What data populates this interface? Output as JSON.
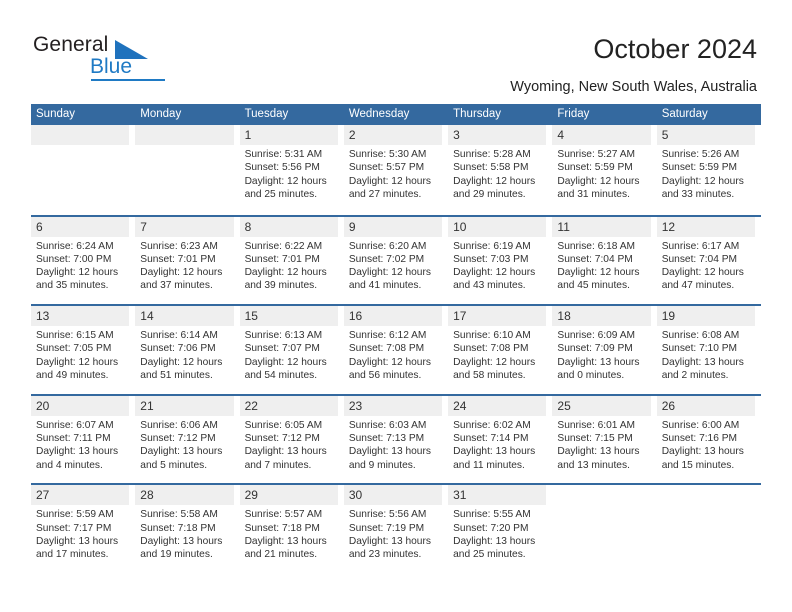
{
  "brand": {
    "name_part1": "General",
    "name_part2": "Blue"
  },
  "header": {
    "title": "October 2024",
    "subtitle": "Wyoming, New South Wales, Australia"
  },
  "calendar": {
    "weekday_headers": [
      "Sunday",
      "Monday",
      "Tuesday",
      "Wednesday",
      "Thursday",
      "Friday",
      "Saturday"
    ],
    "accent_color": "#34699F",
    "numband_color": "#EFEFEF",
    "weeks": [
      [
        {
          "day": "",
          "blank": true
        },
        {
          "day": "",
          "blank": true
        },
        {
          "day": "1",
          "sunrise": "Sunrise: 5:31 AM",
          "sunset": "Sunset: 5:56 PM",
          "daylight1": "Daylight: 12 hours",
          "daylight2": "and 25 minutes."
        },
        {
          "day": "2",
          "sunrise": "Sunrise: 5:30 AM",
          "sunset": "Sunset: 5:57 PM",
          "daylight1": "Daylight: 12 hours",
          "daylight2": "and 27 minutes."
        },
        {
          "day": "3",
          "sunrise": "Sunrise: 5:28 AM",
          "sunset": "Sunset: 5:58 PM",
          "daylight1": "Daylight: 12 hours",
          "daylight2": "and 29 minutes."
        },
        {
          "day": "4",
          "sunrise": "Sunrise: 5:27 AM",
          "sunset": "Sunset: 5:59 PM",
          "daylight1": "Daylight: 12 hours",
          "daylight2": "and 31 minutes."
        },
        {
          "day": "5",
          "sunrise": "Sunrise: 5:26 AM",
          "sunset": "Sunset: 5:59 PM",
          "daylight1": "Daylight: 12 hours",
          "daylight2": "and 33 minutes."
        }
      ],
      [
        {
          "day": "6",
          "sunrise": "Sunrise: 6:24 AM",
          "sunset": "Sunset: 7:00 PM",
          "daylight1": "Daylight: 12 hours",
          "daylight2": "and 35 minutes."
        },
        {
          "day": "7",
          "sunrise": "Sunrise: 6:23 AM",
          "sunset": "Sunset: 7:01 PM",
          "daylight1": "Daylight: 12 hours",
          "daylight2": "and 37 minutes."
        },
        {
          "day": "8",
          "sunrise": "Sunrise: 6:22 AM",
          "sunset": "Sunset: 7:01 PM",
          "daylight1": "Daylight: 12 hours",
          "daylight2": "and 39 minutes."
        },
        {
          "day": "9",
          "sunrise": "Sunrise: 6:20 AM",
          "sunset": "Sunset: 7:02 PM",
          "daylight1": "Daylight: 12 hours",
          "daylight2": "and 41 minutes."
        },
        {
          "day": "10",
          "sunrise": "Sunrise: 6:19 AM",
          "sunset": "Sunset: 7:03 PM",
          "daylight1": "Daylight: 12 hours",
          "daylight2": "and 43 minutes."
        },
        {
          "day": "11",
          "sunrise": "Sunrise: 6:18 AM",
          "sunset": "Sunset: 7:04 PM",
          "daylight1": "Daylight: 12 hours",
          "daylight2": "and 45 minutes."
        },
        {
          "day": "12",
          "sunrise": "Sunrise: 6:17 AM",
          "sunset": "Sunset: 7:04 PM",
          "daylight1": "Daylight: 12 hours",
          "daylight2": "and 47 minutes."
        }
      ],
      [
        {
          "day": "13",
          "sunrise": "Sunrise: 6:15 AM",
          "sunset": "Sunset: 7:05 PM",
          "daylight1": "Daylight: 12 hours",
          "daylight2": "and 49 minutes."
        },
        {
          "day": "14",
          "sunrise": "Sunrise: 6:14 AM",
          "sunset": "Sunset: 7:06 PM",
          "daylight1": "Daylight: 12 hours",
          "daylight2": "and 51 minutes."
        },
        {
          "day": "15",
          "sunrise": "Sunrise: 6:13 AM",
          "sunset": "Sunset: 7:07 PM",
          "daylight1": "Daylight: 12 hours",
          "daylight2": "and 54 minutes."
        },
        {
          "day": "16",
          "sunrise": "Sunrise: 6:12 AM",
          "sunset": "Sunset: 7:08 PM",
          "daylight1": "Daylight: 12 hours",
          "daylight2": "and 56 minutes."
        },
        {
          "day": "17",
          "sunrise": "Sunrise: 6:10 AM",
          "sunset": "Sunset: 7:08 PM",
          "daylight1": "Daylight: 12 hours",
          "daylight2": "and 58 minutes."
        },
        {
          "day": "18",
          "sunrise": "Sunrise: 6:09 AM",
          "sunset": "Sunset: 7:09 PM",
          "daylight1": "Daylight: 13 hours",
          "daylight2": "and 0 minutes."
        },
        {
          "day": "19",
          "sunrise": "Sunrise: 6:08 AM",
          "sunset": "Sunset: 7:10 PM",
          "daylight1": "Daylight: 13 hours",
          "daylight2": "and 2 minutes."
        }
      ],
      [
        {
          "day": "20",
          "sunrise": "Sunrise: 6:07 AM",
          "sunset": "Sunset: 7:11 PM",
          "daylight1": "Daylight: 13 hours",
          "daylight2": "and 4 minutes."
        },
        {
          "day": "21",
          "sunrise": "Sunrise: 6:06 AM",
          "sunset": "Sunset: 7:12 PM",
          "daylight1": "Daylight: 13 hours",
          "daylight2": "and 5 minutes."
        },
        {
          "day": "22",
          "sunrise": "Sunrise: 6:05 AM",
          "sunset": "Sunset: 7:12 PM",
          "daylight1": "Daylight: 13 hours",
          "daylight2": "and 7 minutes."
        },
        {
          "day": "23",
          "sunrise": "Sunrise: 6:03 AM",
          "sunset": "Sunset: 7:13 PM",
          "daylight1": "Daylight: 13 hours",
          "daylight2": "and 9 minutes."
        },
        {
          "day": "24",
          "sunrise": "Sunrise: 6:02 AM",
          "sunset": "Sunset: 7:14 PM",
          "daylight1": "Daylight: 13 hours",
          "daylight2": "and 11 minutes."
        },
        {
          "day": "25",
          "sunrise": "Sunrise: 6:01 AM",
          "sunset": "Sunset: 7:15 PM",
          "daylight1": "Daylight: 13 hours",
          "daylight2": "and 13 minutes."
        },
        {
          "day": "26",
          "sunrise": "Sunrise: 6:00 AM",
          "sunset": "Sunset: 7:16 PM",
          "daylight1": "Daylight: 13 hours",
          "daylight2": "and 15 minutes."
        }
      ],
      [
        {
          "day": "27",
          "sunrise": "Sunrise: 5:59 AM",
          "sunset": "Sunset: 7:17 PM",
          "daylight1": "Daylight: 13 hours",
          "daylight2": "and 17 minutes."
        },
        {
          "day": "28",
          "sunrise": "Sunrise: 5:58 AM",
          "sunset": "Sunset: 7:18 PM",
          "daylight1": "Daylight: 13 hours",
          "daylight2": "and 19 minutes."
        },
        {
          "day": "29",
          "sunrise": "Sunrise: 5:57 AM",
          "sunset": "Sunset: 7:18 PM",
          "daylight1": "Daylight: 13 hours",
          "daylight2": "and 21 minutes."
        },
        {
          "day": "30",
          "sunrise": "Sunrise: 5:56 AM",
          "sunset": "Sunset: 7:19 PM",
          "daylight1": "Daylight: 13 hours",
          "daylight2": "and 23 minutes."
        },
        {
          "day": "31",
          "sunrise": "Sunrise: 5:55 AM",
          "sunset": "Sunset: 7:20 PM",
          "daylight1": "Daylight: 13 hours",
          "daylight2": "and 25 minutes."
        },
        {
          "day": "",
          "empty": true
        },
        {
          "day": "",
          "empty": true
        }
      ]
    ]
  }
}
